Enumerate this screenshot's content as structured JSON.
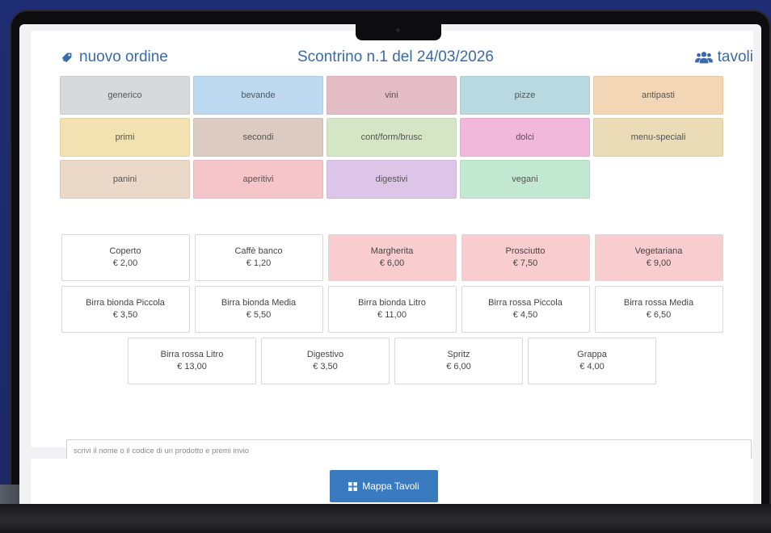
{
  "header": {
    "new_order": "nuovo ordine",
    "receipt_title": "Scontrino n.1 del 24/03/2026",
    "tables": "tavoli"
  },
  "categories": [
    {
      "label": "generico",
      "color": "#d7d9dc"
    },
    {
      "label": "bevande",
      "color": "#bcd9f0"
    },
    {
      "label": "vini",
      "color": "#e3bcc6"
    },
    {
      "label": "pizze",
      "color": "#b9d9e1"
    },
    {
      "label": "antipasti",
      "color": "#f3d6b5"
    },
    {
      "label": "primi",
      "color": "#f2e2b2"
    },
    {
      "label": "secondi",
      "color": "#dccbc2"
    },
    {
      "label": "cont/form/brusc",
      "color": "#d5e6c6"
    },
    {
      "label": "dolci",
      "color": "#f2b8dc"
    },
    {
      "label": "menu-speciali",
      "color": "#e9dcb6"
    },
    {
      "label": "panini",
      "color": "#ead8c9"
    },
    {
      "label": "aperitivi",
      "color": "#f5c5c9"
    },
    {
      "label": "digestivi",
      "color": "#dcc5e6"
    },
    {
      "label": "vegani",
      "color": "#c2e8d1"
    }
  ],
  "products": [
    {
      "name": "Coperto",
      "price": "€ 2,00",
      "highlight": false
    },
    {
      "name": "Caffè banco",
      "price": "€ 1,20",
      "highlight": false
    },
    {
      "name": "Margherita",
      "price": "€ 6,00",
      "highlight": true
    },
    {
      "name": "Prosciutto",
      "price": "€ 7,50",
      "highlight": true
    },
    {
      "name": "Vegetariana",
      "price": "€ 9,00",
      "highlight": true
    },
    {
      "name": "Birra bionda Piccola",
      "price": "€ 3,50",
      "highlight": false
    },
    {
      "name": "Birra bionda Media",
      "price": "€ 5,50",
      "highlight": false
    },
    {
      "name": "Birra bionda Litro",
      "price": "€ 11,00",
      "highlight": false
    },
    {
      "name": "Birra rossa Piccola",
      "price": "€ 4,50",
      "highlight": false
    },
    {
      "name": "Birra rossa Media",
      "price": "€ 6,50",
      "highlight": false
    },
    {
      "name": "Birra rossa Litro",
      "price": "€ 13,00",
      "highlight": false
    },
    {
      "name": "Digestivo",
      "price": "€ 3,50",
      "highlight": false
    },
    {
      "name": "Spritz",
      "price": "€ 6,00",
      "highlight": false
    },
    {
      "name": "Grappa",
      "price": "€ 4,00",
      "highlight": false
    }
  ],
  "search": {
    "placeholder": "scrivi il nome o il codice di un prodotto e premi invio"
  },
  "footer": {
    "map_button": "Mappa Tavoli"
  },
  "colors": {
    "accent": "#3a6aa8",
    "button": "#3a7bc0",
    "highlight": "#f9cdd0"
  }
}
